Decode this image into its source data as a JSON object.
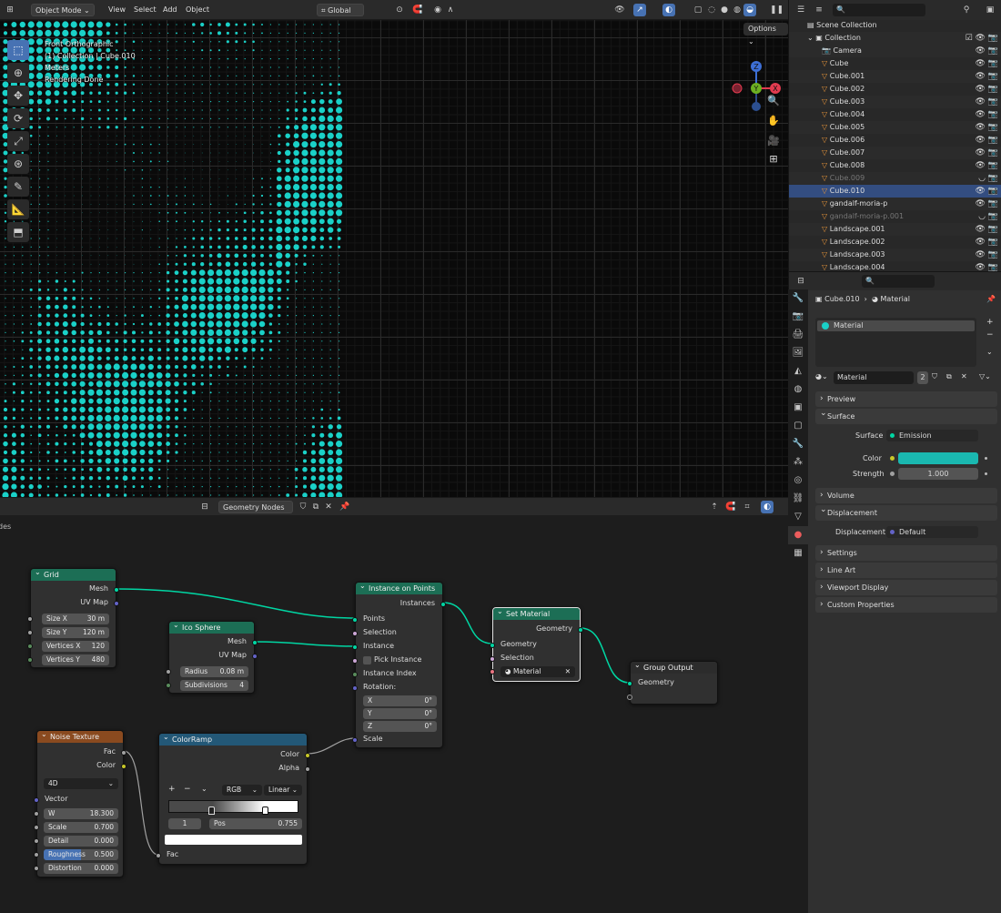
{
  "viewport_header": {
    "mode": "Object Mode",
    "menus": [
      "View",
      "Select",
      "Add",
      "Object"
    ],
    "transform_orientation": "Global",
    "options_label": "Options"
  },
  "viewport": {
    "view_name": "Front Orthographic",
    "collection_info": "(1) Collection | Cube.010",
    "units": "Meters",
    "status": "Rendering Done",
    "gizmo_axes": [
      "Z",
      "Y",
      "X"
    ]
  },
  "node_editor_header": {
    "tree_name": "Geometry Nodes",
    "left_cut_label": "des"
  },
  "nodes": {
    "grid": {
      "title": "Grid",
      "out_mesh": "Mesh",
      "out_uv": "UV Map",
      "fields": [
        {
          "label": "Size X",
          "value": "30 m"
        },
        {
          "label": "Size Y",
          "value": "120 m"
        },
        {
          "label": "Vertices X",
          "value": "120"
        },
        {
          "label": "Vertices Y",
          "value": "480"
        }
      ]
    },
    "ico": {
      "title": "Ico Sphere",
      "out_mesh": "Mesh",
      "out_uv": "UV Map",
      "fields": [
        {
          "label": "Radius",
          "value": "0.08 m"
        },
        {
          "label": "Subdivisions",
          "value": "4"
        }
      ]
    },
    "iop": {
      "title": "Instance on Points",
      "out": "Instances",
      "inputs": [
        "Points",
        "Selection",
        "Instance",
        "Pick Instance",
        "Instance Index",
        "Rotation:",
        "Scale"
      ],
      "rot": [
        {
          "label": "X",
          "value": "0°"
        },
        {
          "label": "Y",
          "value": "0°"
        },
        {
          "label": "Z",
          "value": "0°"
        }
      ]
    },
    "setmat": {
      "title": "Set Material",
      "out": "Geometry",
      "in_geo": "Geometry",
      "in_sel": "Selection",
      "material": "Material"
    },
    "out": {
      "title": "Group Output",
      "in_geo": "Geometry"
    },
    "noise": {
      "title": "Noise Texture",
      "out_fac": "Fac",
      "out_color": "Color",
      "dims": "4D",
      "in_vector": "Vector",
      "fields": [
        {
          "label": "W",
          "value": "18.300"
        },
        {
          "label": "Scale",
          "value": "0.700"
        },
        {
          "label": "Detail",
          "value": "0.000"
        },
        {
          "label": "Roughness",
          "value": "0.500"
        },
        {
          "label": "Distortion",
          "value": "0.000"
        }
      ]
    },
    "ramp": {
      "title": "ColorRamp",
      "out_color": "Color",
      "out_alpha": "Alpha",
      "mode": "RGB",
      "interp": "Linear",
      "index": "1",
      "pos_label": "Pos",
      "pos_value": "0.755",
      "in_fac": "Fac"
    }
  },
  "outliner": {
    "scene": "Scene Collection",
    "collection": "Collection",
    "items": [
      {
        "name": "Camera",
        "dim": false
      },
      {
        "name": "Cube",
        "dim": false
      },
      {
        "name": "Cube.001",
        "dim": false
      },
      {
        "name": "Cube.002",
        "dim": false
      },
      {
        "name": "Cube.003",
        "dim": false
      },
      {
        "name": "Cube.004",
        "dim": false
      },
      {
        "name": "Cube.005",
        "dim": false
      },
      {
        "name": "Cube.006",
        "dim": false
      },
      {
        "name": "Cube.007",
        "dim": false
      },
      {
        "name": "Cube.008",
        "dim": false
      },
      {
        "name": "Cube.009",
        "dim": true
      },
      {
        "name": "Cube.010",
        "dim": false
      },
      {
        "name": "gandalf-moria-p",
        "dim": false
      },
      {
        "name": "gandalf-moria-p.001",
        "dim": true
      },
      {
        "name": "Landscape.001",
        "dim": false
      },
      {
        "name": "Landscape.002",
        "dim": false
      },
      {
        "name": "Landscape.003",
        "dim": false
      },
      {
        "name": "Landscape.004",
        "dim": false
      }
    ]
  },
  "properties": {
    "breadcrumb_object": "Cube.010",
    "breadcrumb_sep": "›",
    "breadcrumb_material": "Material",
    "slot_name": "Material",
    "material_name": "Material",
    "user_count": "2",
    "panels": {
      "preview": "Preview",
      "surface": "Surface",
      "volume": "Volume",
      "displacement": "Displacement",
      "settings": "Settings",
      "lineart": "Line Art",
      "viewport_display": "Viewport Display",
      "custom_props": "Custom Properties"
    },
    "surface_label": "Surface",
    "surface_value": "Emission",
    "color_label": "Color",
    "color_hex": "#1ab8b0",
    "strength_label": "Strength",
    "strength_value": "1.000",
    "disp_label": "Displacement",
    "disp_value": "Default"
  },
  "colors": {
    "accent": "#4772b3",
    "dots": "#1ad1c8",
    "geo_node": "#1c6e55",
    "tex_node": "#8a4a1f",
    "conv_node": "#235877"
  }
}
